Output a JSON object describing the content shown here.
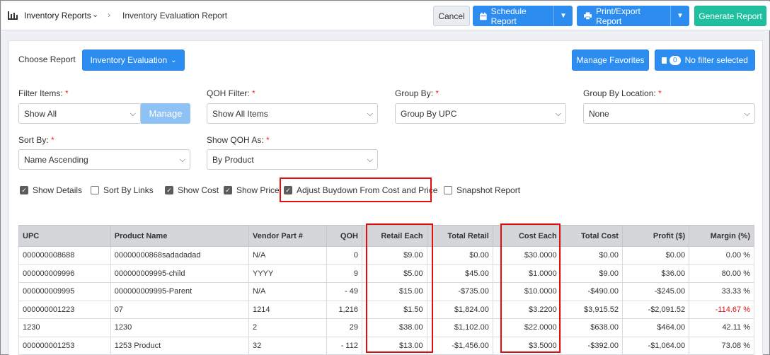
{
  "header": {
    "breadcrumb_root": "Inventory Reports",
    "breadcrumb_current": "Inventory Evaluation Report",
    "cancel_label": "Cancel",
    "schedule_label": "Schedule Report",
    "print_label": "Print/Export Report",
    "generate_label": "Generate Report"
  },
  "report": {
    "choose_label": "Choose Report",
    "selected": "Inventory Evaluation",
    "manage_favorites": "Manage Favorites",
    "filter_count": "0",
    "filter_status": "No filter selected"
  },
  "filters": {
    "filter_items": {
      "label": "Filter Items:",
      "value": "Show All",
      "manage": "Manage"
    },
    "qoh_filter": {
      "label": "QOH Filter:",
      "value": "Show All Items"
    },
    "group_by": {
      "label": "Group By:",
      "value": "Group By UPC"
    },
    "group_by_location": {
      "label": "Group By Location:",
      "value": "None"
    },
    "sort_by": {
      "label": "Sort By:",
      "value": "Name Ascending"
    },
    "show_qoh_as": {
      "label": "Show QOH As:",
      "value": "By Product"
    },
    "required_mark": "*"
  },
  "options": [
    {
      "label": "Show Details",
      "checked": true
    },
    {
      "label": "Sort By Links",
      "checked": false
    },
    {
      "label": "Show Cost",
      "checked": true
    },
    {
      "label": "Show Price",
      "checked": true
    },
    {
      "label": "Adjust Buydown From Cost and Price",
      "checked": true
    },
    {
      "label": "Snapshot Report",
      "checked": false
    }
  ],
  "table": {
    "headers": [
      "UPC",
      "Product Name",
      "Vendor Part #",
      "QOH",
      "Retail Each",
      "Total Retail",
      "Cost Each",
      "Total Cost",
      "Profit ($)",
      "Margin (%)"
    ],
    "rows": [
      [
        "000000008688",
        "00000000868sadadadad",
        "N/A",
        "0",
        "$9.00",
        "$0.00",
        "$30.0000",
        "$0.00",
        "$0.00",
        "0.00 %"
      ],
      [
        "000000009996",
        "000000009995-child",
        "YYYY",
        "9",
        "$5.00",
        "$45.00",
        "$1.0000",
        "$9.00",
        "$36.00",
        "80.00 %"
      ],
      [
        "000000009995",
        "000000009995-Parent",
        "N/A",
        "- 49",
        "$15.00",
        "-$735.00",
        "$10.0000",
        "-$490.00",
        "-$245.00",
        "33.33 %"
      ],
      [
        "000000001223",
        "07",
        "1214",
        "1,216",
        "$1.50",
        "$1,824.00",
        "$3.2200",
        "$3,915.52",
        "-$2,091.52",
        "-114.67 %"
      ],
      [
        "1230",
        "1230",
        "2",
        "29",
        "$38.00",
        "$1,102.00",
        "$22.0000",
        "$638.00",
        "$464.00",
        "42.11 %"
      ],
      [
        "000000001253",
        "1253 Product",
        "32",
        "- 112",
        "$13.00",
        "-$1,456.00",
        "$3.5000",
        "-$392.00",
        "-$1,064.00",
        "73.08 %"
      ]
    ]
  },
  "colors": {
    "primary": "#2d8cf0",
    "success": "#1fbfa0",
    "highlight": "#e01010"
  }
}
